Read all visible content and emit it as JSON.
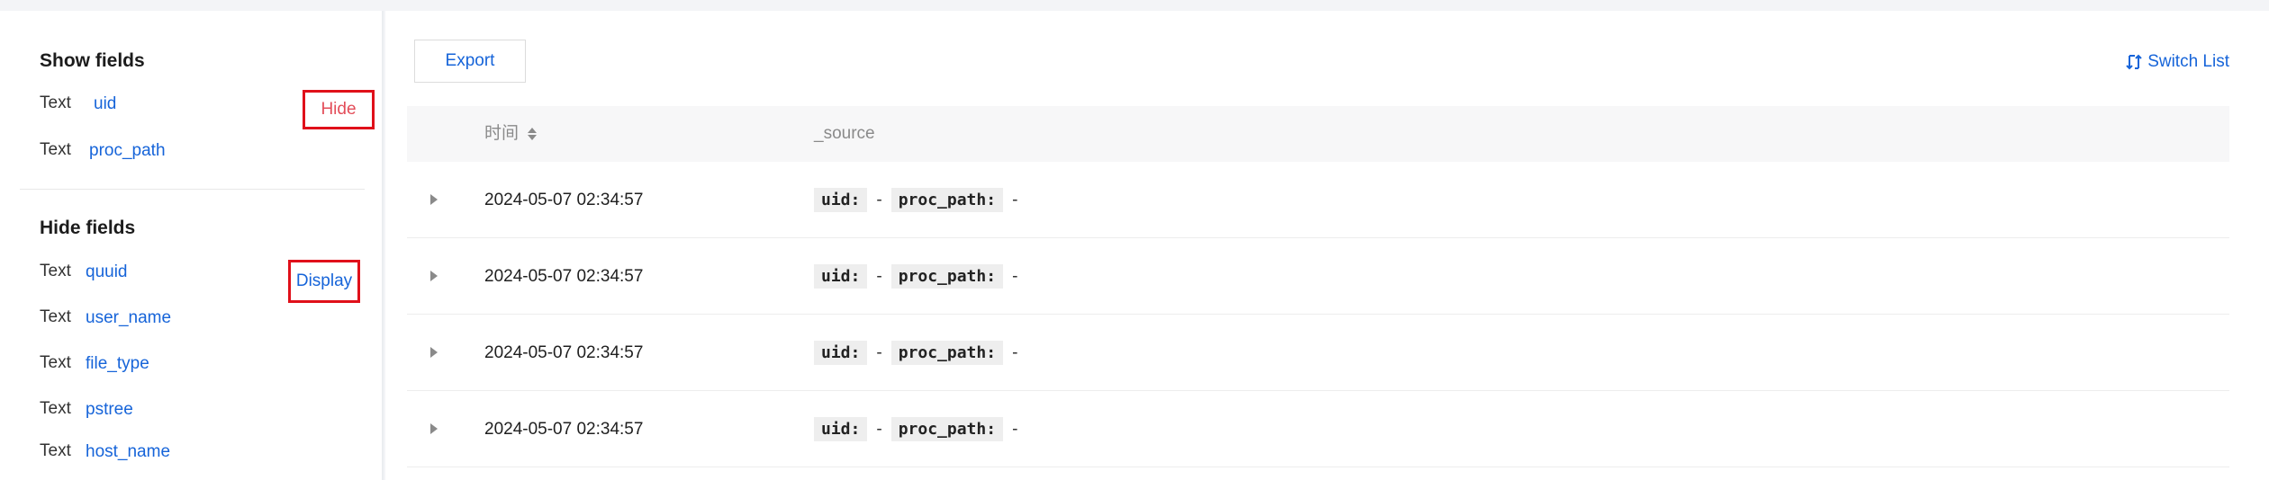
{
  "sidebar": {
    "show_fields_title": "Show fields",
    "show_fields": [
      {
        "type": "Text",
        "name": "uid"
      },
      {
        "type": "Text",
        "name": "proc_path"
      }
    ],
    "hide_button": "Hide",
    "hide_fields_title": "Hide fields",
    "hide_fields": [
      {
        "type": "Text",
        "name": "quuid"
      },
      {
        "type": "Text",
        "name": "user_name"
      },
      {
        "type": "Text",
        "name": "file_type"
      },
      {
        "type": "Text",
        "name": "pstree"
      },
      {
        "type": "Text",
        "name": "host_name"
      }
    ],
    "display_button": "Display"
  },
  "toolbar": {
    "export_label": "Export",
    "switch_list_label": "Switch List"
  },
  "table": {
    "headers": {
      "time": "时间",
      "source": "_source"
    },
    "rows": [
      {
        "time": "2024-05-07 02:34:57",
        "source": [
          {
            "key": "uid:",
            "value": "-"
          },
          {
            "key": "proc_path:",
            "value": "-"
          }
        ]
      },
      {
        "time": "2024-05-07 02:34:57",
        "source": [
          {
            "key": "uid:",
            "value": "-"
          },
          {
            "key": "proc_path:",
            "value": "-"
          }
        ]
      },
      {
        "time": "2024-05-07 02:34:57",
        "source": [
          {
            "key": "uid:",
            "value": "-"
          },
          {
            "key": "proc_path:",
            "value": "-"
          }
        ]
      },
      {
        "time": "2024-05-07 02:34:57",
        "source": [
          {
            "key": "uid:",
            "value": "-"
          },
          {
            "key": "proc_path:",
            "value": "-"
          }
        ]
      }
    ]
  },
  "colors": {
    "link": "#1664d9",
    "highlight_border": "#e0101a",
    "hide_text": "#e34d59"
  }
}
